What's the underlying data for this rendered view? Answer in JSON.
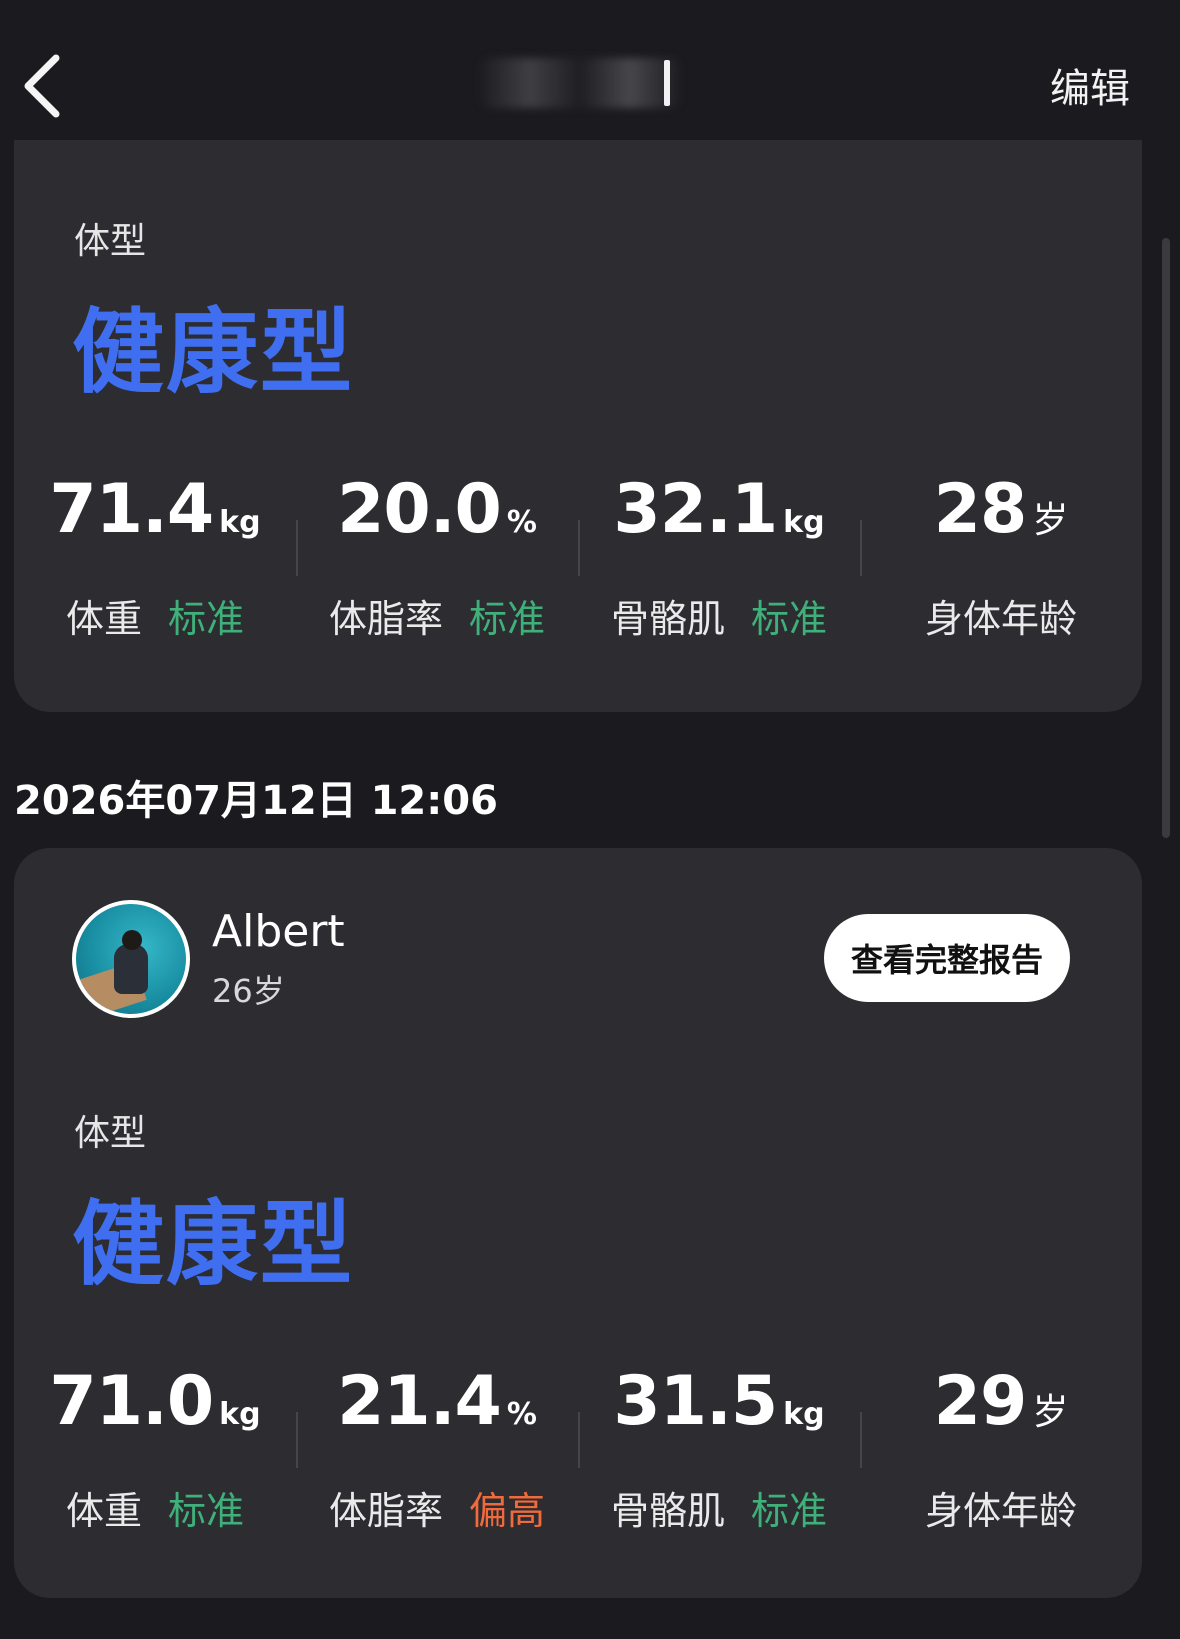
{
  "header": {
    "edit_label": "编辑"
  },
  "colors": {
    "accent_blue": "#3f6ff0",
    "status_normal": "#3fb07a",
    "status_high": "#f06a3c",
    "card_bg": "#2c2c31",
    "page_bg": "#1b1b1f"
  },
  "records": [
    {
      "body_type_label": "体型",
      "body_type_value": "健康型",
      "metrics": [
        {
          "value": "71.4",
          "unit": "kg",
          "label": "体重",
          "status": "标准",
          "status_color": "#3fb07a"
        },
        {
          "value": "20.0",
          "unit": "%",
          "label": "体脂率",
          "status": "标准",
          "status_color": "#3fb07a"
        },
        {
          "value": "32.1",
          "unit": "kg",
          "label": "骨骼肌",
          "status": "标准",
          "status_color": "#3fb07a"
        },
        {
          "value": "28",
          "unit": "岁",
          "label": "身体年龄",
          "status": "",
          "status_color": ""
        }
      ]
    },
    {
      "datetime": "2026年07月12日 12:06",
      "user": {
        "name": "Albert",
        "age": "26岁"
      },
      "report_button_label": "查看完整报告",
      "body_type_label": "体型",
      "body_type_value": "健康型",
      "metrics": [
        {
          "value": "71.0",
          "unit": "kg",
          "label": "体重",
          "status": "标准",
          "status_color": "#3fb07a"
        },
        {
          "value": "21.4",
          "unit": "%",
          "label": "体脂率",
          "status": "偏高",
          "status_color": "#f06a3c"
        },
        {
          "value": "31.5",
          "unit": "kg",
          "label": "骨骼肌",
          "status": "标准",
          "status_color": "#3fb07a"
        },
        {
          "value": "29",
          "unit": "岁",
          "label": "身体年龄",
          "status": "",
          "status_color": ""
        }
      ]
    }
  ]
}
